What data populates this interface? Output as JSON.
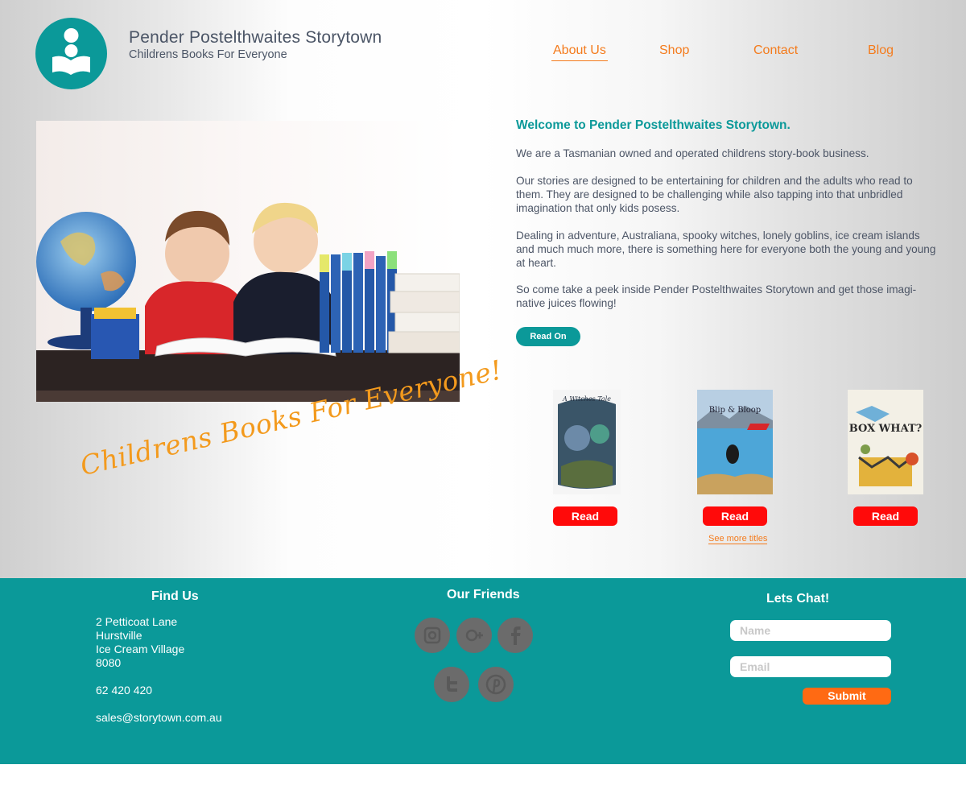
{
  "header": {
    "title": "Pender Postelthwaites Storytown",
    "subtitle": "Childrens Books For Everyone",
    "logo_icon": "reader-book-icon"
  },
  "nav": {
    "items": [
      {
        "label": "About Us",
        "active": true
      },
      {
        "label": "Shop",
        "active": false
      },
      {
        "label": "Contact",
        "active": false
      },
      {
        "label": "Blog",
        "active": false
      }
    ]
  },
  "hero": {
    "tagline": "Childrens Books For Everyone!"
  },
  "intro": {
    "heading": "Welcome to Pender Postelthwaites Storytown.",
    "paragraphs": [
      "We are a Tasmanian owned and operated childrens story-book business.",
      "Our stories are designed to be entertaining for children and the adults who read to them.  They are designed to be challenging while also tapping into that unbridled imagination that only kids posess.",
      "Dealing in adventure, Australiana, spooky witches, lonely goblins, ice cream islands and much much more, there is something here for everyone both the young and young at heart.",
      "So come take a peek inside Pender Postelthwaites Storytown and get those imagi- native juices flowing!"
    ],
    "read_on_label": "Read On"
  },
  "books": {
    "items": [
      {
        "cover_title": "A Witches Tale",
        "read_label": "Read"
      },
      {
        "cover_title": "Blip & Bloop",
        "read_label": "Read"
      },
      {
        "cover_title": "BOX WHAT?",
        "read_label": "Read"
      }
    ],
    "see_more_label": "See more titles"
  },
  "footer": {
    "find_us": {
      "heading": "Find Us",
      "address_lines": [
        "2 Petticoat Lane",
        "Hurstville",
        "Ice Cream Village",
        "8080"
      ],
      "phone": "62 420 420",
      "email": "sales@storytown.com.au"
    },
    "friends": {
      "heading": "Our Friends",
      "icons": [
        "instagram-icon",
        "google-plus-icon",
        "facebook-icon",
        "twitter-icon",
        "pinterest-icon"
      ]
    },
    "chat": {
      "heading": "Lets Chat!",
      "name_placeholder": "Name",
      "email_placeholder": "Email",
      "submit_label": "Submit"
    }
  },
  "colors": {
    "teal": "#0b9999",
    "orange": "#f47b1c",
    "red": "#ff0a0a",
    "submit_orange": "#ff6a13"
  }
}
